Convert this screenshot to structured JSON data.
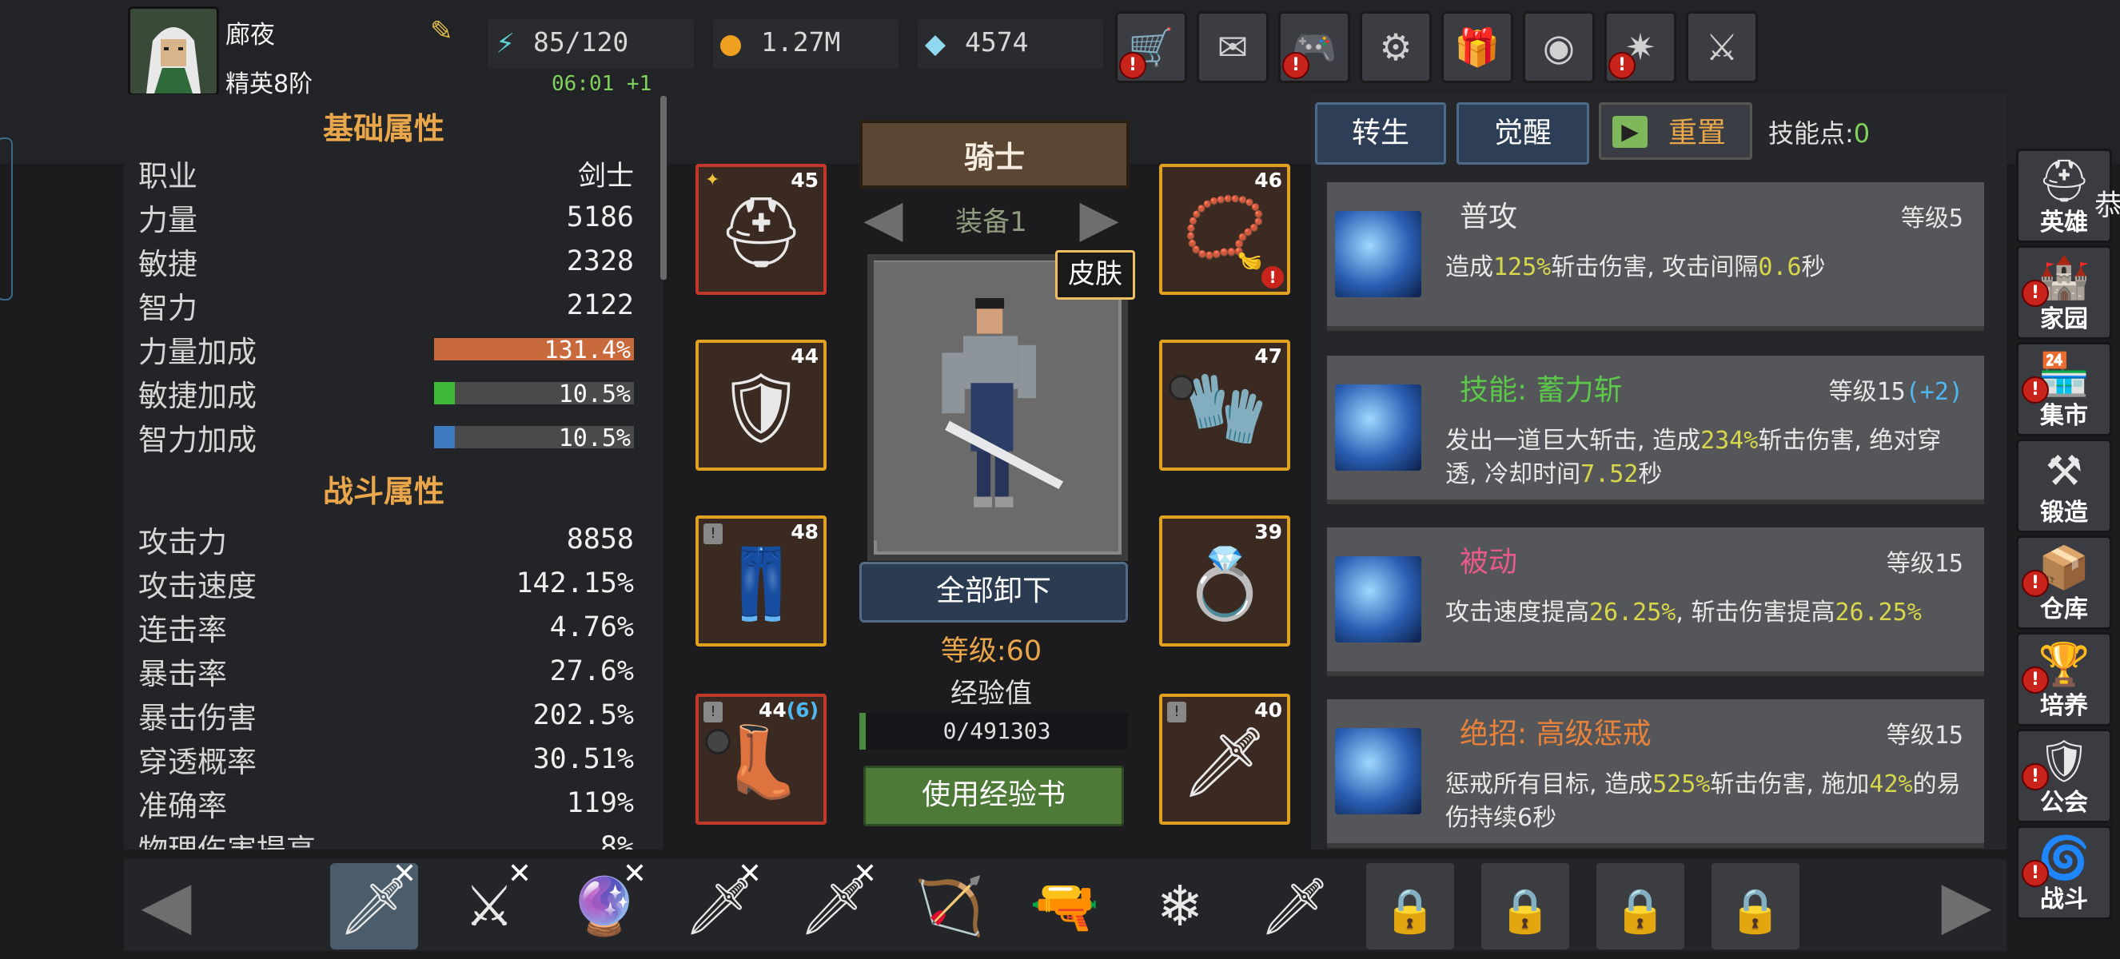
{
  "player": {
    "name": "廊夜",
    "rank": "精英8阶"
  },
  "resources": {
    "energy": "85/120",
    "gold": "1.27M",
    "gems": "4574",
    "timer": "06:01 +1"
  },
  "top_buttons": [
    {
      "name": "shop",
      "icon": "cart-icon",
      "alert": true
    },
    {
      "name": "mail",
      "icon": "mail-icon",
      "alert": false
    },
    {
      "name": "gamepad",
      "icon": "gamepad-icon",
      "alert": true
    },
    {
      "name": "settings",
      "icon": "gear-icon",
      "alert": false
    },
    {
      "name": "gift",
      "icon": "gift-icon",
      "alert": false
    },
    {
      "name": "lucky-wheel",
      "icon": "wheel-icon",
      "alert": false
    },
    {
      "name": "fireworks",
      "icon": "fireworks-icon",
      "alert": true
    },
    {
      "name": "battle",
      "icon": "crossed-swords-icon",
      "alert": false
    }
  ],
  "basic": {
    "title": "基础属性",
    "rows": [
      {
        "label": "职业",
        "value": "剑士"
      },
      {
        "label": "力量",
        "value": "5186"
      },
      {
        "label": "敏捷",
        "value": "2328"
      },
      {
        "label": "智力",
        "value": "2122"
      }
    ],
    "bonus": [
      {
        "label": "力量加成",
        "value": "131.4%",
        "fill": 1.0,
        "color": "#c96a3c"
      },
      {
        "label": "敏捷加成",
        "value": "10.5%",
        "fill": 0.105,
        "color": "#3fb83a"
      },
      {
        "label": "智力加成",
        "value": "10.5%",
        "fill": 0.105,
        "color": "#3d7ac0"
      }
    ]
  },
  "combat": {
    "title": "战斗属性",
    "rows": [
      {
        "label": "攻击力",
        "value": "8858"
      },
      {
        "label": "攻击速度",
        "value": "142.15%"
      },
      {
        "label": "连击率",
        "value": "4.76%"
      },
      {
        "label": "暴击率",
        "value": "27.6%"
      },
      {
        "label": "暴击伤害",
        "value": "202.5%"
      },
      {
        "label": "穿透概率",
        "value": "30.51%"
      },
      {
        "label": "准确率",
        "value": "119%"
      },
      {
        "label": "物理伤害提高",
        "value": "8%"
      }
    ]
  },
  "class_banner": "骑士",
  "equip_set": "装备1",
  "skin_label": "皮肤",
  "unequip_label": "全部卸下",
  "char_level": "等级:60",
  "exp_label": "经验值",
  "exp_value": "0/491303",
  "exp_fill": 0.0,
  "use_exp_book": "使用经验书",
  "slots": [
    {
      "name": "helmet",
      "level": "45",
      "extra": "",
      "border": "#c0392b",
      "icon": "helmet-icon",
      "glyph": "⛑"
    },
    {
      "name": "armor",
      "level": "44",
      "extra": "",
      "border": "#e0a020",
      "icon": "armor-icon",
      "glyph": "🛡"
    },
    {
      "name": "pants",
      "level": "48",
      "extra": "",
      "border": "#e0a020",
      "icon": "pants-icon",
      "glyph": "👖"
    },
    {
      "name": "boots",
      "level": "44",
      "extra": "(6)",
      "border": "#c0392b",
      "icon": "boots-icon",
      "glyph": "👢"
    },
    {
      "name": "necklace",
      "level": "46",
      "extra": "",
      "border": "#e0a020",
      "icon": "necklace-icon",
      "glyph": "📿"
    },
    {
      "name": "gloves",
      "level": "47",
      "extra": "",
      "border": "#e0a020",
      "icon": "gloves-icon",
      "glyph": "🧤"
    },
    {
      "name": "ring",
      "level": "39",
      "extra": "",
      "border": "#e0a020",
      "icon": "ring-icon",
      "glyph": "💍"
    },
    {
      "name": "sword",
      "level": "40",
      "extra": "",
      "border": "#e0a020",
      "icon": "sword-icon",
      "glyph": "🗡"
    }
  ],
  "tabs": {
    "rebirth": "转生",
    "awaken": "觉醒",
    "reset": "重置",
    "skill_points": "技能点:",
    "skill_points_value": "0"
  },
  "skills": [
    {
      "name": "普攻",
      "name_color": "#e8e8e8",
      "level": "等级5",
      "level_bonus": "",
      "desc": [
        "造成",
        "125%",
        "斩击伤害, 攻击间隔",
        "0.6",
        "秒"
      ]
    },
    {
      "name": "技能: 蓄力斩",
      "name_color": "#5cc84a",
      "level": "等级15",
      "level_bonus": "(+2)",
      "desc": [
        "发出一道巨大斩击, 造成",
        "234%",
        "斩击伤害, 绝对穿透, 冷却时间",
        "7.52",
        "秒"
      ]
    },
    {
      "name": "被动",
      "name_color": "#e85a8a",
      "level": "等级15",
      "level_bonus": "",
      "desc": [
        "攻击速度提高",
        "26.25%",
        ", 斩击伤害提高",
        "26.25%",
        ""
      ]
    },
    {
      "name": "绝招: 高级惩戒",
      "name_color": "#e8823a",
      "level": "等级15",
      "level_bonus": "",
      "desc": [
        "惩戒所有目标, 造成",
        "525%",
        "斩击伤害, 施加",
        "42%",
        "的易伤持续6秒"
      ]
    }
  ],
  "right_nav": [
    {
      "label": "英雄",
      "icon": "hero-icon",
      "alert": false
    },
    {
      "label": "家园",
      "icon": "castle-icon",
      "alert": true
    },
    {
      "label": "集市",
      "icon": "market-icon",
      "alert": true
    },
    {
      "label": "锻造",
      "icon": "anvil-icon",
      "alert": false
    },
    {
      "label": "仓库",
      "icon": "warehouse-icon",
      "alert": true
    },
    {
      "label": "培养",
      "icon": "goblet-icon",
      "alert": true
    },
    {
      "label": "公会",
      "icon": "guild-icon",
      "alert": true
    },
    {
      "label": "战斗",
      "icon": "portal-icon",
      "alert": true
    }
  ],
  "edge_text": "恭",
  "roster": [
    {
      "name": "knight",
      "state": "selected",
      "removable": true
    },
    {
      "name": "valkyrie",
      "state": "owned",
      "removable": true
    },
    {
      "name": "mage",
      "state": "owned",
      "removable": true
    },
    {
      "name": "assassin",
      "state": "owned",
      "removable": true
    },
    {
      "name": "dark-knight",
      "state": "owned",
      "removable": true
    },
    {
      "name": "archer",
      "state": "available",
      "removable": false
    },
    {
      "name": "gunner",
      "state": "available",
      "removable": false
    },
    {
      "name": "ice-sorceress",
      "state": "available",
      "removable": false
    },
    {
      "name": "rogue",
      "state": "available",
      "removable": false
    },
    {
      "name": "locked-1",
      "state": "locked",
      "removable": false
    },
    {
      "name": "locked-2",
      "state": "locked",
      "removable": false
    },
    {
      "name": "locked-3",
      "state": "locked",
      "removable": false
    },
    {
      "name": "locked-4",
      "state": "locked",
      "removable": false
    }
  ]
}
